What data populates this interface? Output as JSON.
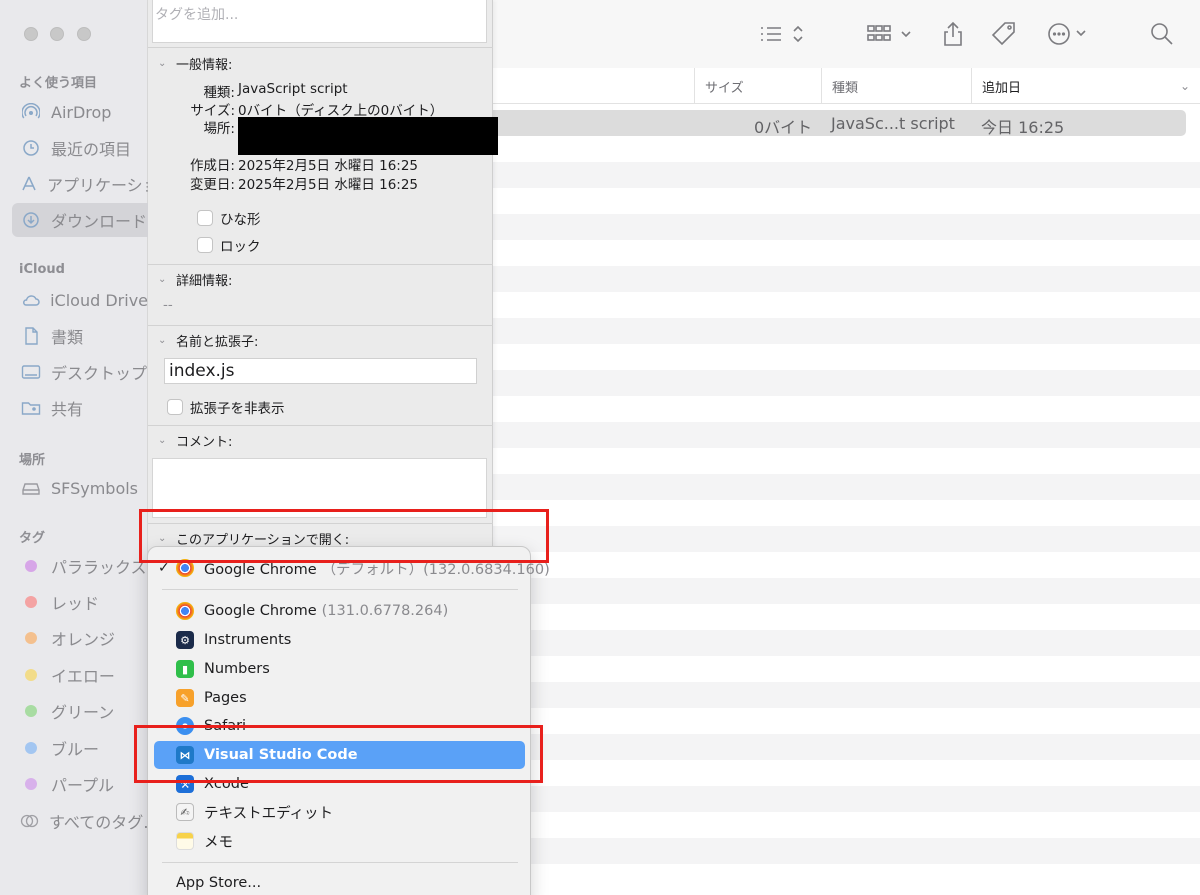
{
  "sidebar": {
    "favorites_header": "よく使う項目",
    "favorites": [
      {
        "label": "AirDrop",
        "icon": "airdrop-icon"
      },
      {
        "label": "最近の項目",
        "icon": "clock-icon"
      },
      {
        "label": "アプリケーション",
        "icon": "applications-icon"
      },
      {
        "label": "ダウンロード",
        "icon": "download-icon"
      }
    ],
    "icloud_header": "iCloud",
    "icloud": [
      {
        "label": "iCloud Drive",
        "icon": "cloud-icon"
      },
      {
        "label": "書類",
        "icon": "document-icon"
      },
      {
        "label": "デスクトップ",
        "icon": "desktop-icon"
      },
      {
        "label": "共有",
        "icon": "shared-folder-icon"
      }
    ],
    "locations_header": "場所",
    "locations": [
      {
        "label": "SFSymbols",
        "icon": "disk-icon"
      }
    ],
    "tags_header": "タグ",
    "tags": [
      {
        "label": "パララックス",
        "color": "#d7a6e8"
      },
      {
        "label": "レッド",
        "color": "#f4a3a3"
      },
      {
        "label": "オレンジ",
        "color": "#f4c08e"
      },
      {
        "label": "イエロー",
        "color": "#f2dc8a"
      },
      {
        "label": "グリーン",
        "color": "#a8dca2"
      },
      {
        "label": "ブルー",
        "color": "#a3c6f1"
      },
      {
        "label": "パープル",
        "color": "#d8b1eb"
      },
      {
        "label": "すべてのタグ…",
        "color": ""
      }
    ]
  },
  "columns": {
    "size": "サイズ",
    "kind": "種類",
    "date_added": "追加日"
  },
  "file_row": {
    "size": "0バイト",
    "kind": "JavaSc...t script",
    "date_added": "今日 16:25"
  },
  "info": {
    "tag_placeholder": "タグを追加...",
    "general_header": "一般情報:",
    "kind_label": "種類:",
    "kind_value": "JavaScript script",
    "size_label": "サイズ:",
    "size_value": "0バイト（ディスク上の0バイト）",
    "where_label": "場所:",
    "created_label": "作成日:",
    "created_value": "2025年2月5日 水曜日 16:25",
    "modified_label": "変更日:",
    "modified_value": "2025年2月5日 水曜日 16:25",
    "stationery_label": "ひな形",
    "locked_label": "ロック",
    "more_info_header": "詳細情報:",
    "more_info_value": "--",
    "name_ext_header": "名前と拡張子:",
    "filename": "index.js",
    "hide_ext_label": "拡張子を非表示",
    "comments_header": "コメント:",
    "open_with_header": "このアプリケーションで開く:"
  },
  "menu": {
    "default_item": {
      "label": "Google Chrome",
      "sub": "（デフォルト）(132.0.6834.160)"
    },
    "items": [
      {
        "label": "Google Chrome",
        "sub": "(131.0.6778.264)",
        "icon": "chrome-icon"
      },
      {
        "label": "Instruments",
        "sub": "",
        "icon": "instruments-icon"
      },
      {
        "label": "Numbers",
        "sub": "",
        "icon": "numbers-icon"
      },
      {
        "label": "Pages",
        "sub": "",
        "icon": "pages-icon"
      },
      {
        "label": "Safari",
        "sub": "",
        "icon": "safari-icon"
      },
      {
        "label": "Visual Studio Code",
        "sub": "",
        "icon": "vscode-icon"
      },
      {
        "label": "Xcode",
        "sub": "",
        "icon": "xcode-icon"
      },
      {
        "label": "テキストエディット",
        "sub": "",
        "icon": "textedit-icon"
      },
      {
        "label": "メモ",
        "sub": "",
        "icon": "notes-icon"
      }
    ],
    "app_store": "App Store..."
  }
}
